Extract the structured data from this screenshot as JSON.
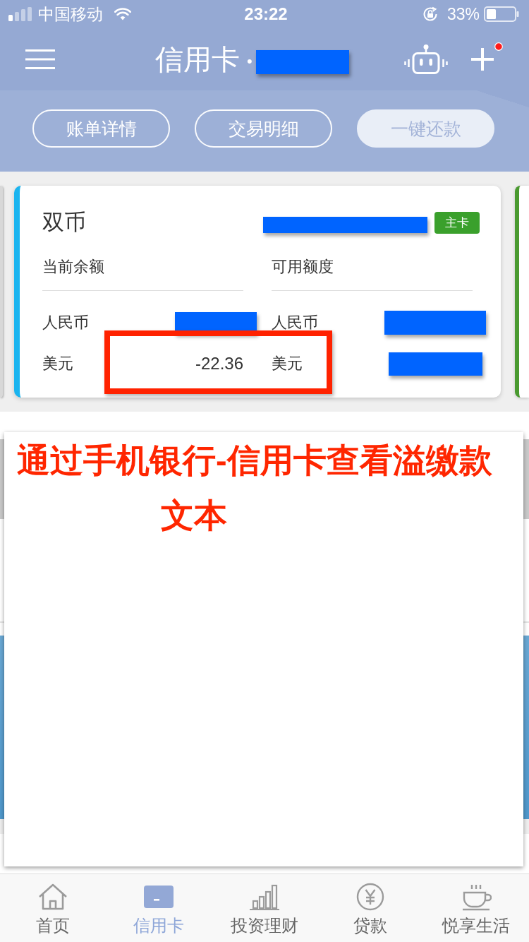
{
  "status_bar": {
    "carrier": "中国移动",
    "time": "23:22",
    "battery": "33%"
  },
  "nav_bar": {
    "title": "信用卡",
    "title_separator": "•",
    "title_redacted": true,
    "plus_badge": true
  },
  "actions": [
    {
      "label": "账单详情",
      "kind": "outline"
    },
    {
      "label": "交易明细",
      "kind": "outline"
    },
    {
      "label": "一键还款",
      "kind": "filled"
    }
  ],
  "card": {
    "name": "双币",
    "number_redacted": true,
    "badge": "主卡",
    "columns": [
      {
        "label": "当前余额",
        "rows": [
          {
            "currency": "人民币",
            "redacted": true,
            "highlighted": false
          },
          {
            "currency": "美元",
            "amount": "-22.36",
            "redacted": false,
            "highlighted": true
          }
        ]
      },
      {
        "label": "可用额度",
        "rows": [
          {
            "currency": "人民币",
            "redacted": true,
            "highlighted": false
          },
          {
            "currency": "美元",
            "redacted": true,
            "highlighted": false
          }
        ]
      }
    ]
  },
  "note": {
    "lines": [
      "通过手机银行-信用卡查看溢缴款",
      "文本"
    ]
  },
  "tabs": [
    {
      "label": "首页",
      "selected": false
    },
    {
      "label": "信用卡",
      "selected": true
    },
    {
      "label": "投资理财",
      "selected": false
    },
    {
      "label": "贷款",
      "selected": false
    },
    {
      "label": "悦享生活",
      "selected": false
    }
  ]
}
